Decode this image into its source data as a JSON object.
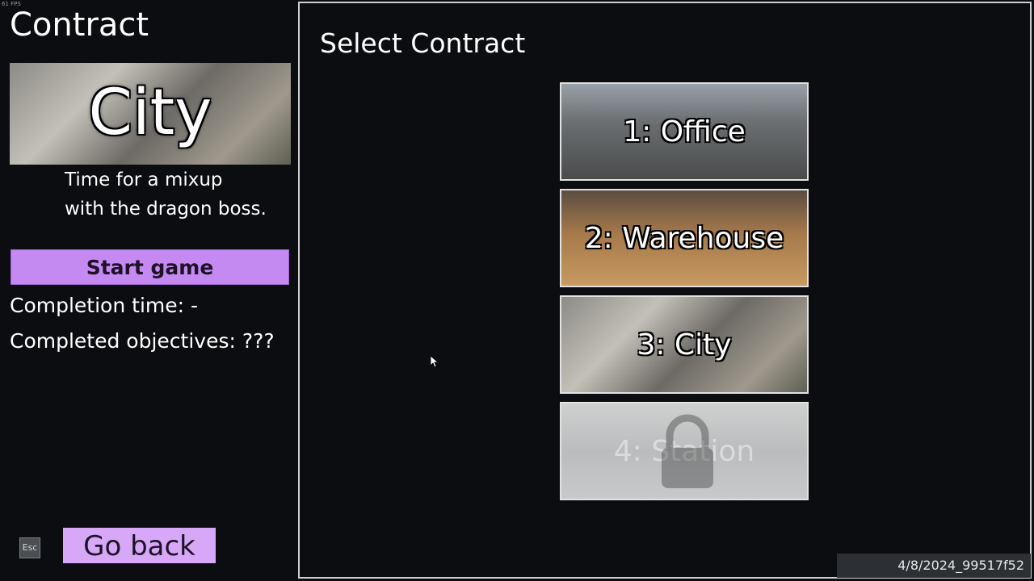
{
  "fps": "61 FPS",
  "left": {
    "title": "Contract",
    "preview_name": "City",
    "description_line1": "Time for a mixup",
    "description_line2": "with the dragon boss.",
    "start_label": "Start game",
    "completion_time": "Completion time: -",
    "completed_objectives": "Completed objectives: ???",
    "esc_label": "Esc",
    "back_label": "Go back"
  },
  "panel": {
    "title": "Select Contract",
    "contracts": [
      {
        "label": "1: Office",
        "locked": false
      },
      {
        "label": "2: Warehouse",
        "locked": false
      },
      {
        "label": "3: City",
        "locked": false
      },
      {
        "label": "4: Station",
        "locked": true
      }
    ]
  },
  "version": "4/8/2024_99517f52",
  "icons": {
    "lock": "lock-icon",
    "cursor": "mouse-cursor-icon"
  },
  "colors": {
    "start_button": "#c58af1",
    "back_button": "#d7a8f8",
    "background": "#0b0d11"
  }
}
